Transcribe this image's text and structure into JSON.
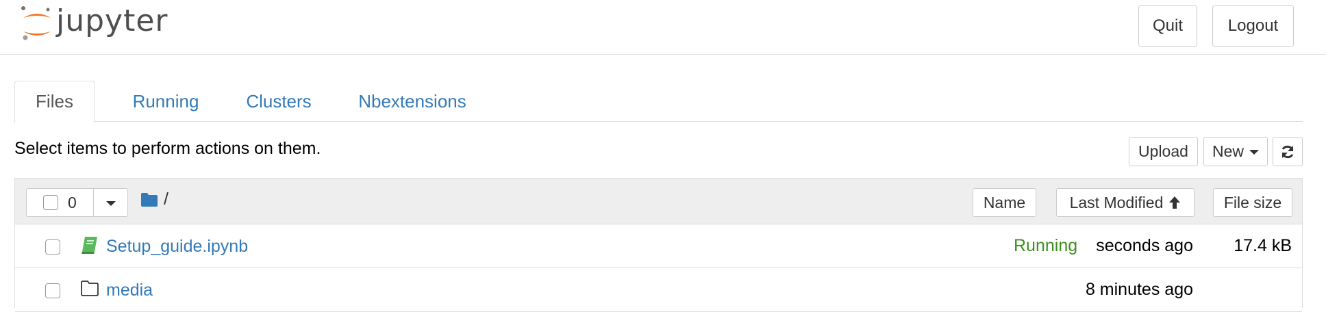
{
  "header": {
    "logo_text": "jupyter",
    "quit_label": "Quit",
    "logout_label": "Logout"
  },
  "tabs": [
    {
      "label": "Files",
      "active": true
    },
    {
      "label": "Running",
      "active": false
    },
    {
      "label": "Clusters",
      "active": false
    },
    {
      "label": "Nbextensions",
      "active": false
    }
  ],
  "toolbar": {
    "hint": "Select items to perform actions on them.",
    "upload_label": "Upload",
    "new_label": "New",
    "refresh_icon": "refresh-icon"
  },
  "list_header": {
    "selected_count": "0",
    "breadcrumb": "/",
    "sort_name_label": "Name",
    "sort_modified_label": "Last Modified",
    "sort_size_label": "File size"
  },
  "files": [
    {
      "name": "Setup_guide.ipynb",
      "type": "notebook",
      "status": "Running",
      "modified": "seconds ago",
      "size": "17.4 kB"
    },
    {
      "name": "media",
      "type": "folder",
      "status": "",
      "modified": "8 minutes ago",
      "size": ""
    }
  ],
  "colors": {
    "link": "#337ab7",
    "running": "#3c8f1f",
    "notebook_icon": "#5cb85c",
    "jupyter_orange": "#f37726"
  }
}
